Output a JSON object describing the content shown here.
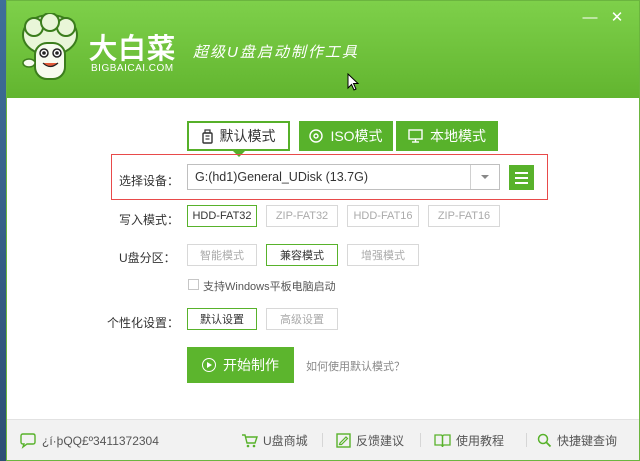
{
  "header": {
    "brand_cn": "大白菜",
    "brand_en": "BIGBAICAI.COM",
    "slogan": "超级U盘启动制作工具",
    "minimize": "—",
    "close": "✕"
  },
  "tabs": [
    {
      "label": "默认模式",
      "active": true
    },
    {
      "label": "ISO模式",
      "active": false
    },
    {
      "label": "本地模式",
      "active": false
    }
  ],
  "device": {
    "label": "选择设备：",
    "value": "G:(hd1)General_UDisk (13.7G)"
  },
  "write_mode": {
    "label": "写入模式：",
    "options": [
      "HDD-FAT32",
      "ZIP-FAT32",
      "HDD-FAT16",
      "ZIP-FAT16"
    ],
    "selected": "HDD-FAT32"
  },
  "partition": {
    "label": "U盘分区：",
    "options": [
      "智能模式",
      "兼容模式",
      "增强模式"
    ],
    "selected": "兼容模式"
  },
  "windows_tablet": {
    "label": "支持Windows平板电脑启动",
    "checked": false
  },
  "personalize": {
    "label": "个性化设置：",
    "options": [
      "默认设置",
      "高级设置"
    ],
    "selected": "默认设置"
  },
  "start_button": "开始制作",
  "help_link": "如何使用默认模式？",
  "footer": {
    "qq": "¿í·þQQ£º3411372304",
    "links": [
      "U盘商城",
      "反馈建议",
      "使用教程",
      "快捷键查询"
    ]
  },
  "colors": {
    "brand_green": "#58b22b",
    "header_green": "#7ed04a",
    "highlight_red": "#e84a4a"
  },
  "icons": [
    "mascot-logo",
    "usb-drive-icon",
    "disc-icon",
    "monitor-icon",
    "chevron-down-icon",
    "menu-icon",
    "play-icon",
    "chat-icon",
    "cart-icon",
    "feedback-icon",
    "book-icon",
    "search-icon"
  ]
}
